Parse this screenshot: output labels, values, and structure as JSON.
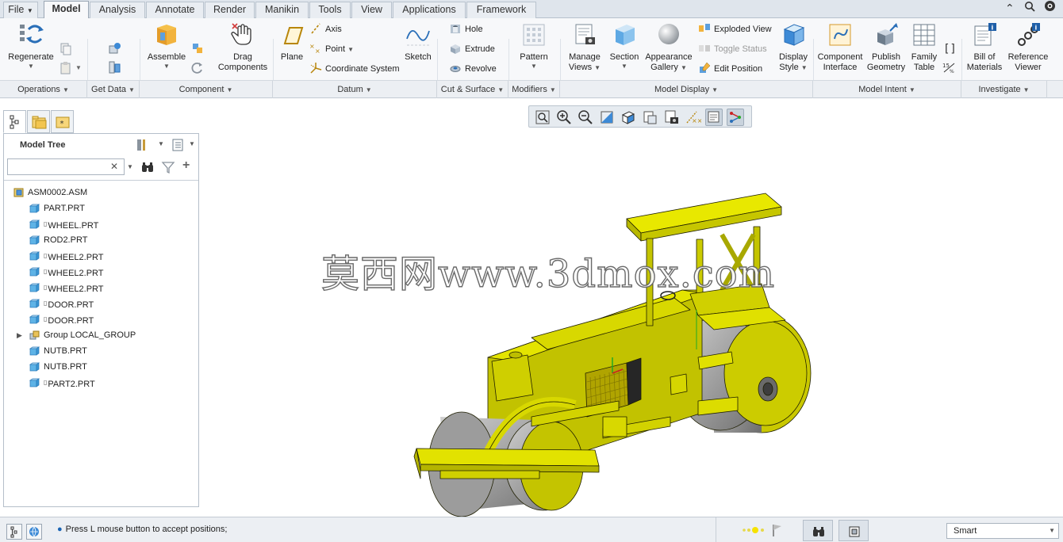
{
  "menu": {
    "tabs": [
      "File",
      "Model",
      "Analysis",
      "Annotate",
      "Render",
      "Manikin",
      "Tools",
      "View",
      "Applications",
      "Framework"
    ],
    "active_tab": "Model"
  },
  "ribbon": {
    "groups": [
      "Operations",
      "Get Data",
      "Component",
      "Datum",
      "Cut & Surface",
      "Modifiers",
      "Model Display",
      "Model Intent",
      "Investigate"
    ],
    "buttons": {
      "regenerate": "Regenerate",
      "assemble": "Assemble",
      "drag_components": [
        "Drag",
        "Components"
      ],
      "plane": "Plane",
      "axis": "Axis",
      "point": "Point",
      "coordinate_system": "Coordinate System",
      "sketch": "Sketch",
      "hole": "Hole",
      "extrude": "Extrude",
      "revolve": "Revolve",
      "pattern": "Pattern",
      "manage_views": [
        "Manage",
        "Views"
      ],
      "section": "Section",
      "appearance_gallery": [
        "Appearance",
        "Gallery"
      ],
      "exploded_view": "Exploded View",
      "toggle_status": "Toggle Status",
      "edit_position": "Edit Position",
      "display_style": [
        "Display",
        "Style"
      ],
      "component_interface": [
        "Component",
        "Interface"
      ],
      "publish_geometry": [
        "Publish",
        "Geometry"
      ],
      "family_table": [
        "Family",
        "Table"
      ],
      "bill_of_materials": [
        "Bill of",
        "Materials"
      ],
      "reference_viewer": [
        "Reference",
        "Viewer"
      ]
    }
  },
  "left_panel": {
    "title": "Model Tree",
    "search_value": "",
    "tree": [
      {
        "label": "ASM0002.ASM",
        "type": "assembly",
        "level": 0,
        "flag": false
      },
      {
        "label": "PART.PRT",
        "type": "part",
        "level": 1,
        "flag": false
      },
      {
        "label": "WHEEL.PRT",
        "type": "part",
        "level": 1,
        "flag": true
      },
      {
        "label": "ROD2.PRT",
        "type": "part",
        "level": 1,
        "flag": false
      },
      {
        "label": "WHEEL2.PRT",
        "type": "part",
        "level": 1,
        "flag": true
      },
      {
        "label": "WHEEL2.PRT",
        "type": "part",
        "level": 1,
        "flag": true
      },
      {
        "label": "WHEEL2.PRT",
        "type": "part",
        "level": 1,
        "flag": true
      },
      {
        "label": "DOOR.PRT",
        "type": "part",
        "level": 1,
        "flag": true
      },
      {
        "label": "DOOR.PRT",
        "type": "part",
        "level": 1,
        "flag": true
      },
      {
        "label": "Group LOCAL_GROUP",
        "type": "group",
        "level": 1,
        "flag": false,
        "expandable": true
      },
      {
        "label": "NUTB.PRT",
        "type": "part",
        "level": 1,
        "flag": false
      },
      {
        "label": "NUTB.PRT",
        "type": "part",
        "level": 1,
        "flag": false
      },
      {
        "label": "PART2.PRT",
        "type": "part",
        "level": 1,
        "flag": true
      }
    ]
  },
  "graphics": {
    "watermark": "莫西网www.3dmox.com",
    "model_color": "#d4d400",
    "roller_color": "#a8a8a8"
  },
  "status": {
    "message": "Press L mouse button to accept positions;",
    "filter": "Smart"
  },
  "colors": {
    "ribbon_bg": "#f7f8fa",
    "tab_bg": "#dfe5ec",
    "accent_blue": "#2a6fb8"
  }
}
